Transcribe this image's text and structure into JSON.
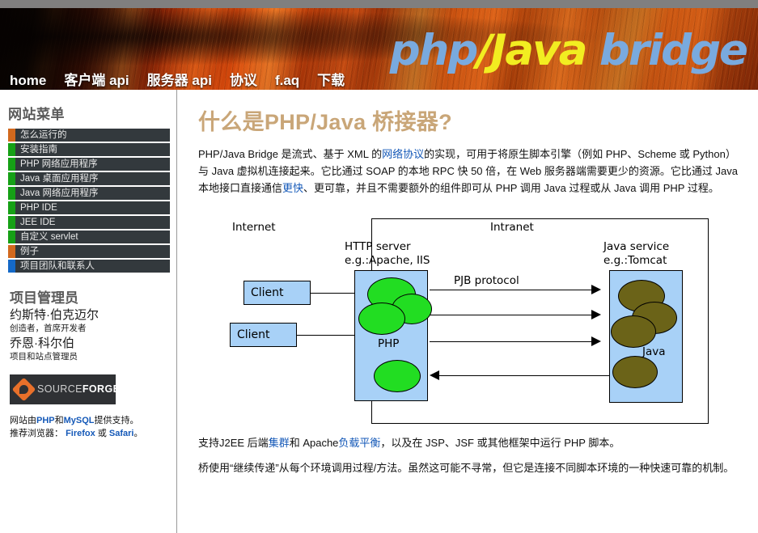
{
  "header": {
    "logo": {
      "part1": "php",
      "part2": "/Java",
      "part3": " bridge"
    },
    "nav": [
      {
        "label": "home"
      },
      {
        "label": "客户端 api"
      },
      {
        "label": "服务器 api"
      },
      {
        "label": "协议"
      },
      {
        "label": "f.aq"
      },
      {
        "label": "下载"
      }
    ]
  },
  "sidebar": {
    "menu_title": "网站菜单",
    "items": [
      {
        "label": "怎么运行的",
        "color": "#d2691e"
      },
      {
        "label": "安装指南",
        "color": "#16a016"
      },
      {
        "label": "PHP 网络应用程序",
        "color": "#16a016"
      },
      {
        "label": "Java 桌面应用程序",
        "color": "#16a016"
      },
      {
        "label": "Java 网络应用程序",
        "color": "#16a016"
      },
      {
        "label": "PHP IDE",
        "color": "#16a016"
      },
      {
        "label": "JEE IDE",
        "color": "#16a016"
      },
      {
        "label": "自定义 servlet",
        "color": "#16a016"
      },
      {
        "label": "例子",
        "color": "#d2691e"
      },
      {
        "label": "项目团队和联系人",
        "color": "#1569c7"
      }
    ],
    "admin_title": "项目管理员",
    "people": [
      {
        "name": "约斯特·伯克迈尔",
        "role": "创造者，首席开发者"
      },
      {
        "name": "乔恩·科尔伯",
        "role": "项目和站点管理员"
      }
    ],
    "sourceforge": {
      "part1": "SOURCE",
      "part2": "FORGE"
    },
    "footer": {
      "line1_pre": "网站由",
      "line1_link1": "PHP",
      "line1_mid": "和",
      "line1_link2": "MySQL",
      "line1_post": "提供支持。",
      "line2_pre": "推荐浏览器：",
      "line2_link1": "Firefox",
      "line2_mid": "或",
      "line2_link2": "Safari",
      "line2_post": "。"
    }
  },
  "content": {
    "title": "什么是PHP/Java 桥接器?",
    "para1": {
      "t1": "PHP/Java Bridge 是流式、基于 XML 的",
      "link1": "网络协议",
      "t2": "的实现，可用于将原生脚本引擎（例如 PHP、Scheme 或 Python）与 Java 虚拟机连接起来。它比通过 SOAP 的本地 RPC 快 50 倍，在 Web 服务器端需要更少的资源。它比通过 Java 本地接口直接通信",
      "link2": "更快",
      "t3": "、更可靠，并且不需要额外的组件即可从 PHP 调用 Java 过程或从 Java 调用 PHP 过程。"
    },
    "para2": {
      "t1": "支持J2EE 后端",
      "link1": "集群",
      "t2": "和 Apache",
      "link2": "负载平衡",
      "t3": "，以及在 JSP、JSF 或其他框架中运行 PHP 脚本。"
    },
    "para3": "桥使用“继续传递”从每个环境调用过程/方法。虽然这可能不寻常，但它是连接不同脚本环境的一种快速可靠的机制。"
  },
  "diagram": {
    "internet_label": "Internet",
    "intranet_label": "Intranet",
    "http_label_l1": "HTTP server",
    "http_label_l2": "e.g.:Apache, IIS",
    "java_label_l1": "Java service",
    "java_label_l2": "e.g.:Tomcat",
    "protocol_label": "PJB protocol",
    "client1": "Client",
    "client2": "Client",
    "php_label": "PHP",
    "java_box_label": "Java",
    "colors": {
      "box_fill": "#a8d1f7",
      "php_ellipse": "#22dd22",
      "java_ellipse": "#6b6318"
    }
  }
}
